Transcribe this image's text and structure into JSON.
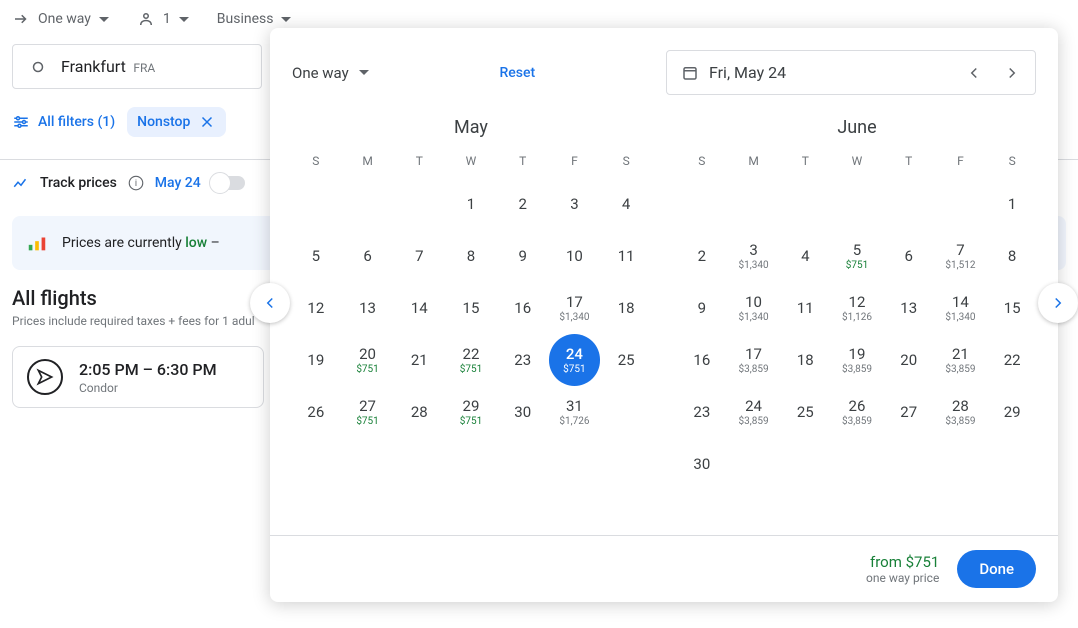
{
  "topbar": {
    "trip_type": "One way",
    "passengers": "1",
    "cabin": "Business"
  },
  "origin": {
    "city": "Frankfurt",
    "code": "FRA"
  },
  "filters": {
    "all_label": "All filters (1)",
    "chip_nonstop": "Nonstop"
  },
  "track": {
    "label": "Track prices",
    "date": "May 24"
  },
  "banner": {
    "text_prefix": "Prices are currently ",
    "text_status": "low",
    "text_suffix": " –"
  },
  "results": {
    "heading": "All flights",
    "subtext": "Prices include required taxes + fees for 1 adul"
  },
  "flight": {
    "times": "2:05 PM – 6:30 PM",
    "airline": "Condor"
  },
  "datepicker": {
    "trip_type": "One way",
    "reset": "Reset",
    "selected_date": "Fri, May 24",
    "footer_from": "from $751",
    "footer_sub": "one way price",
    "done": "Done",
    "weekday_labels": [
      "S",
      "M",
      "T",
      "W",
      "T",
      "F",
      "S"
    ],
    "months": [
      {
        "name": "May",
        "leading_blanks": 3,
        "days": [
          {
            "n": 1
          },
          {
            "n": 2
          },
          {
            "n": 3
          },
          {
            "n": 4
          },
          {
            "n": 5
          },
          {
            "n": 6
          },
          {
            "n": 7
          },
          {
            "n": 8
          },
          {
            "n": 9
          },
          {
            "n": 10
          },
          {
            "n": 11
          },
          {
            "n": 12
          },
          {
            "n": 13
          },
          {
            "n": 14
          },
          {
            "n": 15
          },
          {
            "n": 16
          },
          {
            "n": 17,
            "price": "$1,340"
          },
          {
            "n": 18
          },
          {
            "n": 19
          },
          {
            "n": 20,
            "price": "$751",
            "green": true
          },
          {
            "n": 21
          },
          {
            "n": 22,
            "price": "$751",
            "green": true
          },
          {
            "n": 23
          },
          {
            "n": 24,
            "price": "$751",
            "selected": true
          },
          {
            "n": 25
          },
          {
            "n": 26
          },
          {
            "n": 27,
            "price": "$751",
            "green": true
          },
          {
            "n": 28
          },
          {
            "n": 29,
            "price": "$751",
            "green": true
          },
          {
            "n": 30
          },
          {
            "n": 31,
            "price": "$1,726"
          }
        ]
      },
      {
        "name": "June",
        "leading_blanks": 6,
        "days": [
          {
            "n": 1
          },
          {
            "n": 2
          },
          {
            "n": 3,
            "price": "$1,340"
          },
          {
            "n": 4
          },
          {
            "n": 5,
            "price": "$751",
            "green": true
          },
          {
            "n": 6
          },
          {
            "n": 7,
            "price": "$1,512"
          },
          {
            "n": 8
          },
          {
            "n": 9
          },
          {
            "n": 10,
            "price": "$1,340"
          },
          {
            "n": 11
          },
          {
            "n": 12,
            "price": "$1,126"
          },
          {
            "n": 13
          },
          {
            "n": 14,
            "price": "$1,340"
          },
          {
            "n": 15
          },
          {
            "n": 16
          },
          {
            "n": 17,
            "price": "$3,859"
          },
          {
            "n": 18
          },
          {
            "n": 19,
            "price": "$3,859"
          },
          {
            "n": 20
          },
          {
            "n": 21,
            "price": "$3,859"
          },
          {
            "n": 22
          },
          {
            "n": 23
          },
          {
            "n": 24,
            "price": "$3,859"
          },
          {
            "n": 25
          },
          {
            "n": 26,
            "price": "$3,859"
          },
          {
            "n": 27
          },
          {
            "n": 28,
            "price": "$3,859"
          },
          {
            "n": 29
          },
          {
            "n": 30
          }
        ]
      }
    ]
  }
}
